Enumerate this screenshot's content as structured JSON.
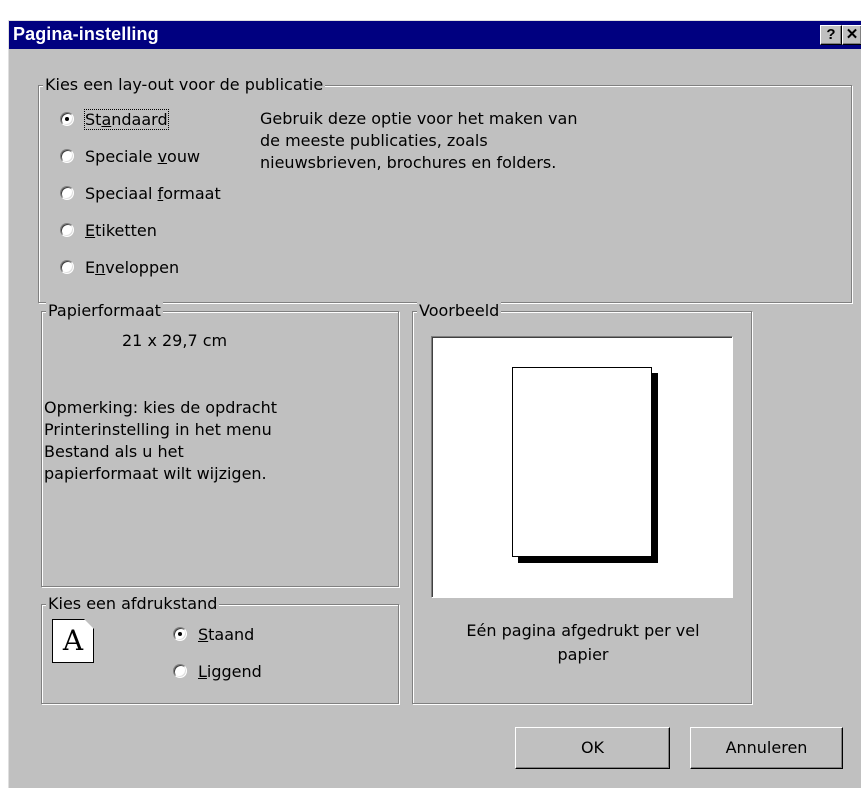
{
  "dialog": {
    "title": "Pagina-instelling",
    "help_button": "?",
    "close_button": "✕"
  },
  "layout_group": {
    "legend": "Kies een lay-out voor de publicatie",
    "options": [
      {
        "pre": "St",
        "key": "a",
        "post": "ndaard",
        "selected": true
      },
      {
        "pre": "Speciale ",
        "key": "v",
        "post": "ouw",
        "selected": false
      },
      {
        "pre": "Speciaal ",
        "key": "f",
        "post": "ormaat",
        "selected": false
      },
      {
        "pre": "",
        "key": "E",
        "post": "tiketten",
        "selected": false
      },
      {
        "pre": "E",
        "key": "n",
        "post": "veloppen",
        "selected": false
      }
    ],
    "description_lines": [
      "Gebruik deze optie voor het maken van",
      "de meeste publicaties, zoals",
      "nieuwsbrieven, brochures en folders."
    ]
  },
  "paper_group": {
    "legend": "Papierformaat",
    "size": "21 x 29,7 cm",
    "note_lines": [
      "Opmerking: kies de opdracht",
      "Printerinstelling in het menu",
      "Bestand als u het",
      "papierformaat wilt wijzigen."
    ]
  },
  "orientation_group": {
    "legend": "Kies een afdrukstand",
    "icon_letter": "A",
    "options": [
      {
        "pre": "",
        "key": "S",
        "post": "taand",
        "selected": true
      },
      {
        "pre": "",
        "key": "L",
        "post": "iggend",
        "selected": false
      }
    ]
  },
  "preview_group": {
    "legend": "Voorbeeld",
    "caption_lines": [
      "Eén pagina afgedrukt per vel",
      "papier"
    ]
  },
  "buttons": {
    "ok": "OK",
    "cancel": "Annuleren"
  }
}
